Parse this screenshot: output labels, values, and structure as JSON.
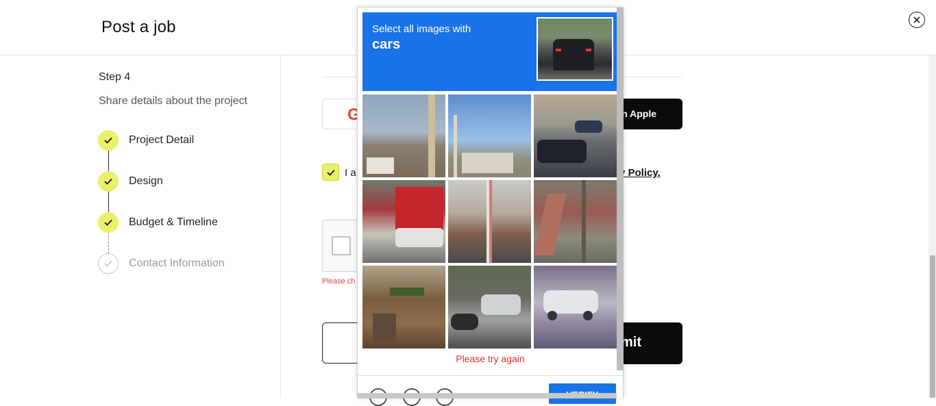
{
  "header": {
    "title": "Post a job"
  },
  "sidebar": {
    "step_label": "Step 4",
    "step_desc": "Share details about the project",
    "steps": [
      {
        "label": "Project Detail",
        "done": true
      },
      {
        "label": "Design",
        "done": true
      },
      {
        "label": "Budget & Timeline",
        "done": true
      },
      {
        "label": "Contact Information",
        "done": false
      }
    ]
  },
  "form": {
    "google_icon": "G",
    "apple_label": "n Apple",
    "terms_text": "I a",
    "privacy_link": "y Policy.",
    "captcha_error": "Please ch",
    "submit_label": "mit"
  },
  "captcha": {
    "instruction": "Select all images with",
    "target": "cars",
    "tiles_count": 9,
    "error": "Please try again",
    "verify_label": "VERIFY"
  },
  "colors": {
    "accent_yellow": "#ebf06a",
    "captcha_blue": "#1a73e8",
    "error_red": "#d93025"
  }
}
